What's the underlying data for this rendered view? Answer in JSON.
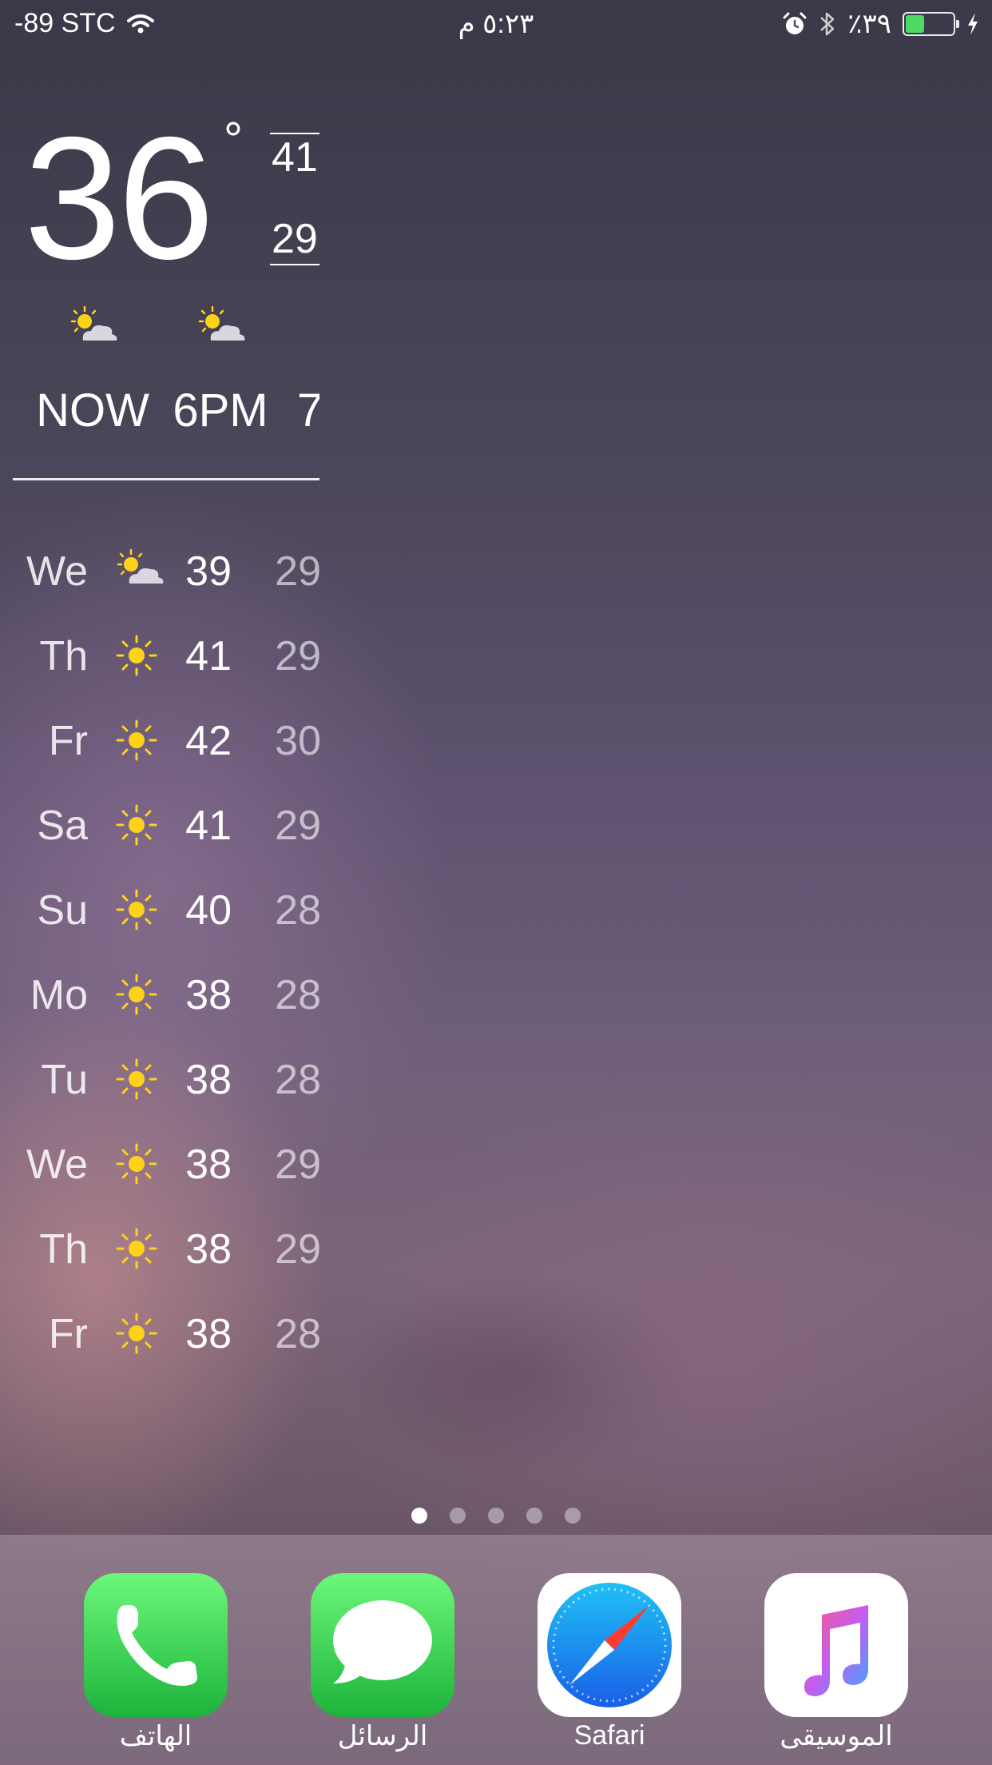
{
  "status_bar": {
    "carrier": "-89 STC",
    "time": "٥:٢٣ م",
    "battery_percent": "٪٣٩",
    "battery_level": 0.39
  },
  "weather": {
    "current_temp": "36",
    "degree_symbol": "°",
    "high": "41",
    "low": "29",
    "hourly": [
      {
        "label": "NOW",
        "icon": "partly-cloudy-icon"
      },
      {
        "label": "6PM",
        "icon": "partly-cloudy-icon"
      },
      {
        "label": "7",
        "icon": ""
      }
    ],
    "daily": [
      {
        "day": "We",
        "icon": "partly-cloudy-icon",
        "high": "39",
        "low": "29"
      },
      {
        "day": "Th",
        "icon": "sun-icon",
        "high": "41",
        "low": "29"
      },
      {
        "day": "Fr",
        "icon": "sun-icon",
        "high": "42",
        "low": "30"
      },
      {
        "day": "Sa",
        "icon": "sun-icon",
        "high": "41",
        "low": "29"
      },
      {
        "day": "Su",
        "icon": "sun-icon",
        "high": "40",
        "low": "28"
      },
      {
        "day": "Mo",
        "icon": "sun-icon",
        "high": "38",
        "low": "28"
      },
      {
        "day": "Tu",
        "icon": "sun-icon",
        "high": "38",
        "low": "28"
      },
      {
        "day": "We",
        "icon": "sun-icon",
        "high": "38",
        "low": "29"
      },
      {
        "day": "Th",
        "icon": "sun-icon",
        "high": "38",
        "low": "29"
      },
      {
        "day": "Fr",
        "icon": "sun-icon",
        "high": "38",
        "low": "28"
      }
    ]
  },
  "page_indicator": {
    "count": 5,
    "active": 0
  },
  "dock": {
    "apps": [
      {
        "label": "الهاتف",
        "icon": "phone-icon"
      },
      {
        "label": "الرسائل",
        "icon": "messages-icon"
      },
      {
        "label": "Safari",
        "icon": "safari-icon"
      },
      {
        "label": "الموسيقى",
        "icon": "music-icon"
      }
    ]
  },
  "colors": {
    "sun": "#ffd21a",
    "battery_fill": "#4cd964",
    "green_tile": "#1db33b",
    "safari_blue": "#1a7cf0",
    "music_pink": "#ff3b6b"
  }
}
